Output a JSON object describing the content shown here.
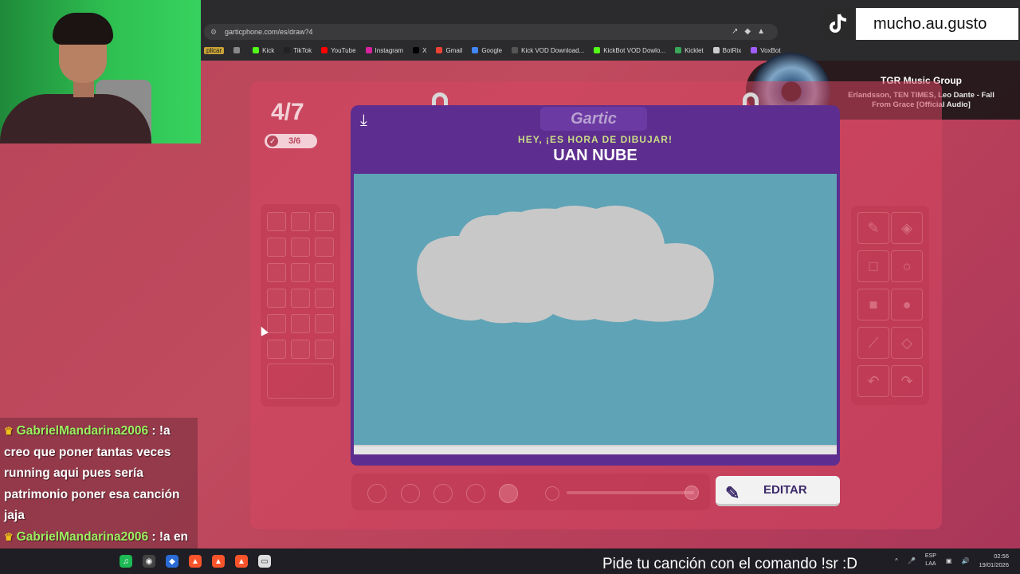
{
  "browser": {
    "url": "garticphone.com/es/draw?4",
    "bookmarks": [
      {
        "label": "plicar",
        "color": "#c7a235"
      },
      {
        "label": "",
        "color": "#888888"
      },
      {
        "label": "Kick",
        "color": "#53fc18"
      },
      {
        "label": "TikTok",
        "color": "#222222"
      },
      {
        "label": "YouTube",
        "color": "#ff0000"
      },
      {
        "label": "Instagram",
        "color": "#d6249f"
      },
      {
        "label": "X",
        "color": "#000000"
      },
      {
        "label": "Gmail",
        "color": "#ea4335"
      },
      {
        "label": "Google",
        "color": "#4285f4"
      },
      {
        "label": "Kick VOD Download...",
        "color": "#555555"
      },
      {
        "label": "KickBot VOD Dowlo...",
        "color": "#53fc18"
      },
      {
        "label": "Kicklet",
        "color": "#3aa657"
      },
      {
        "label": "BotRix",
        "color": "#cccccc"
      },
      {
        "label": "VoxBot",
        "color": "#a15cff"
      }
    ]
  },
  "tiktok": {
    "username": "mucho.au.gusto"
  },
  "music": {
    "group": "TGR Music Group",
    "track": "Erlandsson, TEN TIMES, Leo Dante - Fall From Grace [Official Audio]"
  },
  "game": {
    "round": "4/7",
    "done": "3/6",
    "logo": "Gartic",
    "subtitle": "HEY, ¡ES HORA DE DIBUJAR!",
    "word": "UAN NUBE",
    "edit_label": "EDITAR",
    "canvas_color": "#5fa3b6",
    "drawing_color": "#c8c8c8"
  },
  "chat": {
    "messages": [
      {
        "user": "GabrielMandarina2006",
        "text": " : !a creo que poner tantas veces running aqui pues sería patrimonio poner esa canción jaja"
      },
      {
        "user": "GabrielMandarina2006",
        "text": " : !a en el live osea xd"
      }
    ]
  },
  "stream": {
    "marquee": "Pide tu canción con el comando !sr :D"
  },
  "taskbar": {
    "lang1": "ESP",
    "lang2": "LAA",
    "time": "02:56",
    "date": "19/01/2026"
  },
  "colors": {
    "accent": "#5d2e8f",
    "background": "#b8455a",
    "username": "#9af05f"
  }
}
